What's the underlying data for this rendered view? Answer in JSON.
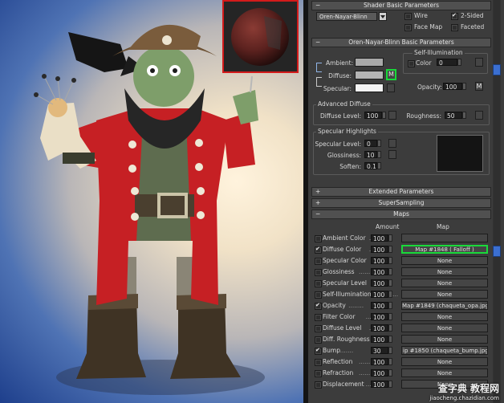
{
  "shader_basic": {
    "header": "Shader Basic Parameters",
    "shader_type": "Oren-Nayar-Blinn",
    "wire_label": "Wire",
    "two_sided_label": "2-Sided",
    "face_map_label": "Face Map",
    "faceted_label": "Faceted",
    "wire_checked": false,
    "two_sided_checked": true,
    "face_map_checked": false,
    "faceted_checked": false
  },
  "onb_params": {
    "header": "Oren-Nayar-Blinn Basic Parameters",
    "ambient_label": "Ambient:",
    "diffuse_label": "Diffuse:",
    "specular_label": "Specular:",
    "diffuse_map_button": "M",
    "self_illum": {
      "title": "Self-Illumination",
      "color_label": "Color",
      "color_value": "0",
      "color_checked": false
    },
    "opacity_label": "Opacity:",
    "opacity_value": "100",
    "opacity_map_button": "M",
    "colors": {
      "ambient": "#a9a9a9",
      "diffuse": "#b4b4b4",
      "specular": "#f2f2f2"
    }
  },
  "advanced_diffuse": {
    "title": "Advanced Diffuse",
    "diffuse_level_label": "Diffuse Level:",
    "diffuse_level_value": "100",
    "roughness_label": "Roughness:",
    "roughness_value": "50"
  },
  "specular_highlights": {
    "title": "Specular Highlights",
    "level_label": "Specular Level:",
    "level_value": "0",
    "glossiness_label": "Glossiness:",
    "glossiness_value": "10",
    "soften_label": "Soften:",
    "soften_value": "0.1"
  },
  "rollouts": {
    "extended": "Extended Parameters",
    "supersampling": "SuperSampling",
    "maps": "Maps"
  },
  "maps": {
    "col_amount": "Amount",
    "col_map": "Map",
    "rows": [
      {
        "label": "Ambient Color",
        "amount": "100",
        "map": "",
        "checked": false,
        "highlight": false
      },
      {
        "label": "Diffuse Color",
        "amount": "100",
        "map": "Map #1848  ( Falloff )",
        "checked": true,
        "highlight": true
      },
      {
        "label": "Specular Color",
        "amount": "100",
        "map": "None",
        "checked": false,
        "highlight": false
      },
      {
        "label": "Glossiness",
        "amount": "100",
        "map": "None",
        "checked": false,
        "highlight": false
      },
      {
        "label": "Specular Level",
        "amount": "100",
        "map": "None",
        "checked": false,
        "highlight": false
      },
      {
        "label": "Self-Illumination",
        "amount": "100",
        "map": "None",
        "checked": false,
        "highlight": false
      },
      {
        "label": "Opacity",
        "amount": "100",
        "map": "Map #1849 (chaqueta_opa.jpg",
        "checked": true,
        "highlight": false
      },
      {
        "label": "Filter Color",
        "amount": "100",
        "map": "None",
        "checked": false,
        "highlight": false
      },
      {
        "label": "Diffuse Level",
        "amount": "100",
        "map": "None",
        "checked": false,
        "highlight": false
      },
      {
        "label": "Diff. Roughness",
        "amount": "100",
        "map": "None",
        "checked": false,
        "highlight": false
      },
      {
        "label": "Bump",
        "amount": "30",
        "map": "ip #1850 (chaqueta_bump.jpg)",
        "checked": true,
        "highlight": false
      },
      {
        "label": "Reflection",
        "amount": "100",
        "map": "None",
        "checked": false,
        "highlight": false
      },
      {
        "label": "Refraction",
        "amount": "100",
        "map": "None",
        "checked": false,
        "highlight": false
      },
      {
        "label": "Displacement",
        "amount": "100",
        "map": "None",
        "checked": false,
        "highlight": false
      }
    ]
  },
  "watermark": {
    "line1": "查字典 教程网",
    "line2": "jiaocheng.chazidian.com"
  }
}
